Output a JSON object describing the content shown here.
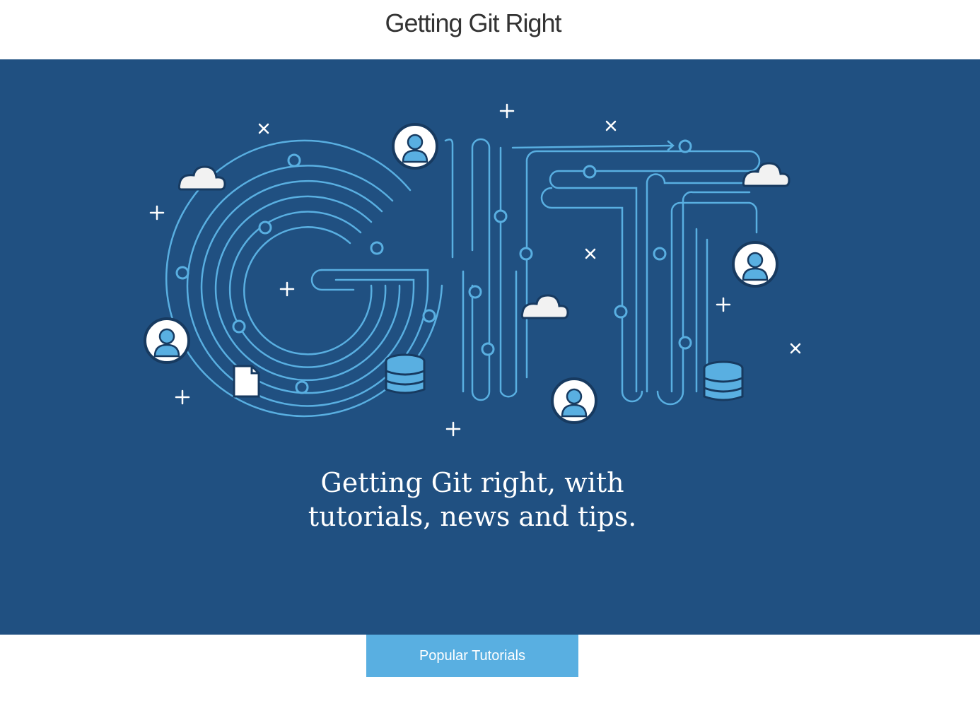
{
  "header": {
    "title": "Getting Git Right"
  },
  "hero": {
    "tagline_line1": "Getting Git right, with",
    "tagline_line2": "tutorials, news and tips.",
    "background_color": "#205081",
    "line_color": "#59afe1"
  },
  "tabs": [
    {
      "label": "Popular Tutorials"
    }
  ]
}
